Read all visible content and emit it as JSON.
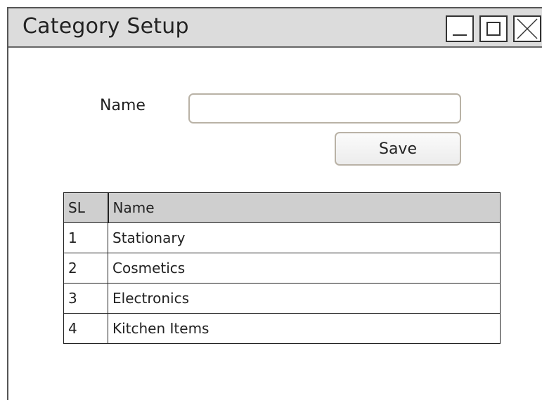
{
  "window": {
    "title": "Category Setup",
    "controls": {
      "minimize_icon": "minimize-icon",
      "maximize_icon": "maximize-icon",
      "close_icon": "close-icon"
    }
  },
  "form": {
    "name_label": "Name",
    "name_value": "",
    "name_placeholder": "",
    "save_label": "Save"
  },
  "table": {
    "columns": [
      "SL",
      "Name"
    ],
    "rows": [
      {
        "sl": "1",
        "name": "Stationary"
      },
      {
        "sl": "2",
        "name": "Cosmetics"
      },
      {
        "sl": "3",
        "name": "Electronics"
      },
      {
        "sl": "4",
        "name": "Kitchen Items"
      }
    ]
  },
  "colors": {
    "titlebar": "#dcdcdc",
    "header_row": "#cfcfcf",
    "input_border": "#b9b2a6"
  }
}
